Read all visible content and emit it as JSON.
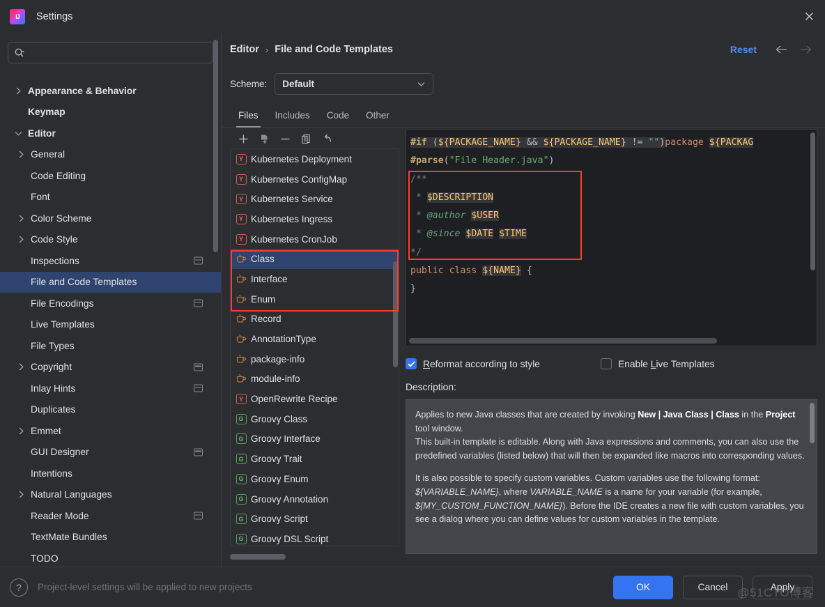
{
  "window": {
    "title": "Settings",
    "logo_icon": "intellij-idea-logo",
    "close_icon": "close-icon"
  },
  "sidebar": {
    "search": {
      "placeholder": "",
      "value": "",
      "icon": "search-icon"
    },
    "items": [
      {
        "label": "Appearance & Behavior",
        "level": 1,
        "chevron": "right",
        "bold": true,
        "selected": false,
        "project_badge": false
      },
      {
        "label": "Keymap",
        "level": 1,
        "chevron": "none",
        "bold": true,
        "selected": false,
        "project_badge": false
      },
      {
        "label": "Editor",
        "level": 1,
        "chevron": "down",
        "bold": true,
        "selected": false,
        "project_badge": false
      },
      {
        "label": "General",
        "level": 2,
        "chevron": "right",
        "bold": false,
        "selected": false,
        "project_badge": false
      },
      {
        "label": "Code Editing",
        "level": 2,
        "chevron": "none",
        "bold": false,
        "selected": false,
        "project_badge": false
      },
      {
        "label": "Font",
        "level": 2,
        "chevron": "none",
        "bold": false,
        "selected": false,
        "project_badge": false
      },
      {
        "label": "Color Scheme",
        "level": 2,
        "chevron": "right",
        "bold": false,
        "selected": false,
        "project_badge": false
      },
      {
        "label": "Code Style",
        "level": 2,
        "chevron": "right",
        "bold": false,
        "selected": false,
        "project_badge": false
      },
      {
        "label": "Inspections",
        "level": 2,
        "chevron": "none",
        "bold": false,
        "selected": false,
        "project_badge": true
      },
      {
        "label": "File and Code Templates",
        "level": 2,
        "chevron": "none",
        "bold": false,
        "selected": true,
        "project_badge": false
      },
      {
        "label": "File Encodings",
        "level": 2,
        "chevron": "none",
        "bold": false,
        "selected": false,
        "project_badge": true
      },
      {
        "label": "Live Templates",
        "level": 2,
        "chevron": "none",
        "bold": false,
        "selected": false,
        "project_badge": false
      },
      {
        "label": "File Types",
        "level": 2,
        "chevron": "none",
        "bold": false,
        "selected": false,
        "project_badge": false
      },
      {
        "label": "Copyright",
        "level": 2,
        "chevron": "right",
        "bold": false,
        "selected": false,
        "project_badge": true
      },
      {
        "label": "Inlay Hints",
        "level": 2,
        "chevron": "none",
        "bold": false,
        "selected": false,
        "project_badge": true
      },
      {
        "label": "Duplicates",
        "level": 2,
        "chevron": "none",
        "bold": false,
        "selected": false,
        "project_badge": false
      },
      {
        "label": "Emmet",
        "level": 2,
        "chevron": "right",
        "bold": false,
        "selected": false,
        "project_badge": false
      },
      {
        "label": "GUI Designer",
        "level": 2,
        "chevron": "none",
        "bold": false,
        "selected": false,
        "project_badge": true
      },
      {
        "label": "Intentions",
        "level": 2,
        "chevron": "none",
        "bold": false,
        "selected": false,
        "project_badge": false
      },
      {
        "label": "Natural Languages",
        "level": 2,
        "chevron": "right",
        "bold": false,
        "selected": false,
        "project_badge": false
      },
      {
        "label": "Reader Mode",
        "level": 2,
        "chevron": "none",
        "bold": false,
        "selected": false,
        "project_badge": true
      },
      {
        "label": "TextMate Bundles",
        "level": 2,
        "chevron": "none",
        "bold": false,
        "selected": false,
        "project_badge": false
      },
      {
        "label": "TODO",
        "level": 2,
        "chevron": "none",
        "bold": false,
        "selected": false,
        "project_badge": false
      }
    ]
  },
  "header": {
    "breadcrumb": [
      "Editor",
      "File and Code Templates"
    ],
    "separator": "›",
    "reset_label": "Reset",
    "back_icon": "arrow-left-icon",
    "forward_icon": "arrow-right-icon",
    "reset_color": "#548af7"
  },
  "scheme": {
    "label": "Scheme:",
    "value": "Default",
    "chevron_icon": "chevron-down-icon"
  },
  "tabs": [
    {
      "label": "Files",
      "active": true
    },
    {
      "label": "Includes",
      "active": false
    },
    {
      "label": "Code",
      "active": false
    },
    {
      "label": "Other",
      "active": false
    }
  ],
  "list_toolbar": [
    {
      "icon": "plus-icon",
      "tooltip": "Add"
    },
    {
      "icon": "copy-file-icon",
      "tooltip": "Create Template from File"
    },
    {
      "icon": "minus-icon",
      "tooltip": "Remove"
    },
    {
      "icon": "duplicate-icon",
      "tooltip": "Copy"
    },
    {
      "icon": "undo-icon",
      "tooltip": "Reset to Default"
    }
  ],
  "templates": [
    {
      "label": "Kubernetes Deployment",
      "icon": "yaml-file-icon",
      "selected": false
    },
    {
      "label": "Kubernetes ConfigMap",
      "icon": "yaml-file-icon",
      "selected": false
    },
    {
      "label": "Kubernetes Service",
      "icon": "yaml-file-icon",
      "selected": false
    },
    {
      "label": "Kubernetes Ingress",
      "icon": "yaml-file-icon",
      "selected": false
    },
    {
      "label": "Kubernetes CronJob",
      "icon": "yaml-file-icon",
      "selected": false
    },
    {
      "label": "Class",
      "icon": "java-file-icon",
      "selected": true
    },
    {
      "label": "Interface",
      "icon": "java-file-icon",
      "selected": false
    },
    {
      "label": "Enum",
      "icon": "java-file-icon",
      "selected": false
    },
    {
      "label": "Record",
      "icon": "java-file-icon",
      "selected": false
    },
    {
      "label": "AnnotationType",
      "icon": "java-file-icon",
      "selected": false
    },
    {
      "label": "package-info",
      "icon": "java-file-icon",
      "selected": false
    },
    {
      "label": "module-info",
      "icon": "java-file-icon",
      "selected": false
    },
    {
      "label": "OpenRewrite Recipe",
      "icon": "yaml-file-icon",
      "selected": false
    },
    {
      "label": "Groovy Class",
      "icon": "groovy-file-icon",
      "selected": false
    },
    {
      "label": "Groovy Interface",
      "icon": "groovy-file-icon",
      "selected": false
    },
    {
      "label": "Groovy Trait",
      "icon": "groovy-file-icon",
      "selected": false
    },
    {
      "label": "Groovy Enum",
      "icon": "groovy-file-icon",
      "selected": false
    },
    {
      "label": "Groovy Annotation",
      "icon": "groovy-file-icon",
      "selected": false
    },
    {
      "label": "Groovy Script",
      "icon": "groovy-file-icon",
      "selected": false
    },
    {
      "label": "Groovy DSL Script",
      "icon": "groovy-file-icon",
      "selected": false
    }
  ],
  "code": {
    "line1_a": "#if",
    "line1_b": " (",
    "line1_var1": "${PACKAGE_NAME}",
    "line1_amp": " && ",
    "line1_var2": "${PACKAGE_NAME}",
    "line1_neq": " != ",
    "line1_str": "\"\"",
    "line1_close": ")",
    "line1_pkg": "package ",
    "line1_var3": "${PACKAG",
    "line2_a": "#parse",
    "line2_b": "(",
    "line2_str": "\"File Header.java\"",
    "line2_c": ")",
    "line3": "/**",
    "line4_star": " * ",
    "line4_var": "$DESCRIPTION",
    "line5_star": " * ",
    "line5_tag": "@author ",
    "line5_var": "$USER",
    "line6_star": " * ",
    "line6_tag": "@since ",
    "line6_var1": "$DATE",
    "line6_sp": " ",
    "line6_var2": "$TIME",
    "line7": "*/",
    "line8_kw": "public class ",
    "line8_var": "${NAME}",
    "line8_brace": " {",
    "line9": "}"
  },
  "checkboxes": [
    {
      "label": "Reformat according to style",
      "checked": true,
      "mnemonic": "R"
    },
    {
      "label": "Enable Live Templates",
      "checked": false,
      "mnemonic": "L"
    }
  ],
  "description": {
    "label": "Description:",
    "p1_a": "Applies to new Java classes that are created by invoking ",
    "p1_b": "New | Java Class | Class",
    "p1_c": " in the ",
    "p1_d": "Project",
    "p1_e": " tool window.",
    "p1_f": "This built-in template is editable. Along with Java expressions and comments, you can also use the predefined variables (listed below) that will then be expanded like macros into corresponding values.",
    "p2_a": "It is also possible to specify custom variables. Custom variables use the following format: ",
    "p2_b": "${VARIABLE_NAME}",
    "p2_c": ", where ",
    "p2_d": "VARIABLE_NAME",
    "p2_e": " is a name for your variable (for example, ",
    "p2_f": "${MY_CUSTOM_FUNCTION_NAME}",
    "p2_g": "). Before the IDE creates a new file with custom variables, you see a dialog where you can define values for custom variables in the template."
  },
  "footer": {
    "help_icon": "help-question-icon",
    "note": "Project-level settings will be applied to new projects",
    "ok_label": "OK",
    "cancel_label": "Cancel",
    "apply_label": "Apply",
    "primary_color": "#3574f0"
  },
  "watermark": {
    "text": "@51CTO博客"
  },
  "annotations": {
    "rect_code": "highlight around javadoc comment block",
    "rect_list": "highlight around Class / Interface / Enum list items",
    "color": "#ff3a30"
  }
}
